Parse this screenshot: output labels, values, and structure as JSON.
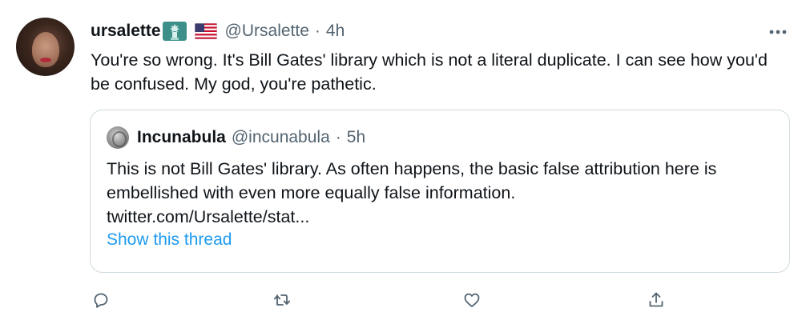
{
  "tweet": {
    "display_name": "ursalette",
    "badge_icon": "statue-of-liberty-icon",
    "flag_icon": "us-flag-icon",
    "handle": "@Ursalette",
    "separator": "·",
    "time": "4h",
    "text": "You're so wrong. It's Bill Gates' library which is not a literal duplicate. I can see how you'd be confused. My god, you're pathetic.",
    "more_icon": "more-options-icon"
  },
  "quote": {
    "display_name": "Incunabula",
    "handle": "@incunabula",
    "separator": "·",
    "time": "5h",
    "text": "This is not Bill Gates' library. As often happens, the basic false attribution here is embellished with even more equally false information.",
    "link": "twitter.com/Ursalette/stat...",
    "show_thread": "Show this thread"
  },
  "actions": [
    {
      "name": "reply",
      "icon": "reply-icon"
    },
    {
      "name": "retweet",
      "icon": "retweet-icon"
    },
    {
      "name": "like",
      "icon": "heart-icon"
    },
    {
      "name": "share",
      "icon": "share-icon"
    }
  ],
  "colors": {
    "text": "#0f1419",
    "secondary": "#536471",
    "link": "#1d9bf0",
    "border": "#cfd9de"
  }
}
